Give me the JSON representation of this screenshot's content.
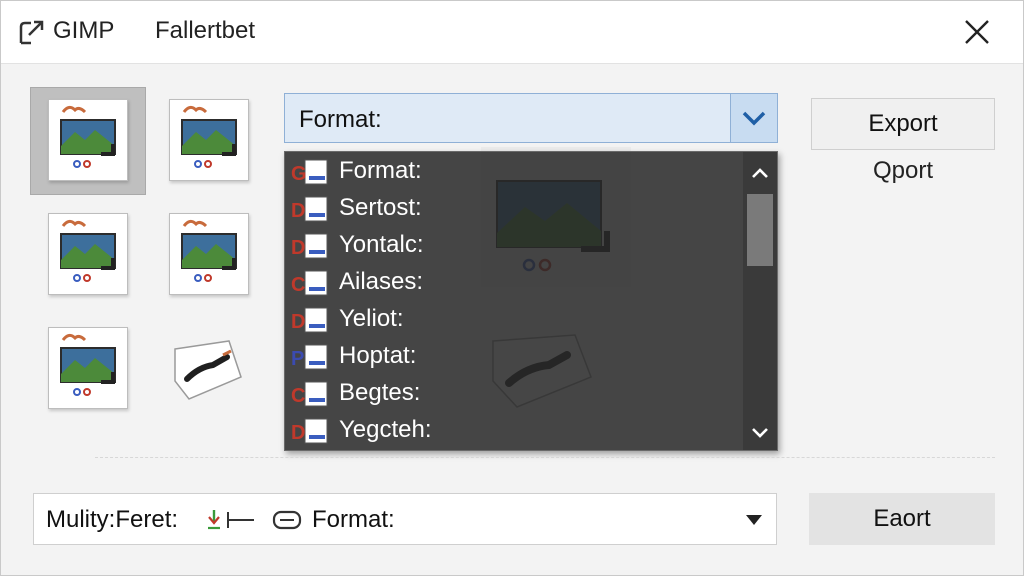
{
  "titlebar": {
    "app_name": "GIMP",
    "window_title": "Fallertbet"
  },
  "thumbnails": [
    {
      "icon": "image-file-icon",
      "selected": true
    },
    {
      "icon": "image-file-icon",
      "selected": false
    },
    {
      "icon": "image-file-icon",
      "selected": false
    },
    {
      "icon": "image-file-icon",
      "selected": false
    },
    {
      "icon": "image-file-icon",
      "selected": false
    },
    {
      "icon": "brush-stroke-icon",
      "selected": false
    }
  ],
  "format_select": {
    "label": "Format:"
  },
  "dropdown": {
    "items": [
      {
        "label": "Format:",
        "badge": "G",
        "badge_color": "#c0392b"
      },
      {
        "label": "Sertost:",
        "badge": "D",
        "badge_color": "#c0392b"
      },
      {
        "label": "Yontalc:",
        "badge": "D",
        "badge_color": "#c0392b"
      },
      {
        "label": "Ailases:",
        "badge": "C",
        "badge_color": "#c0392b"
      },
      {
        "label": "Yeliot:",
        "badge": "D",
        "badge_color": "#c0392b"
      },
      {
        "label": "Hoptat:",
        "badge": "P",
        "badge_color": "#3b4bb0"
      },
      {
        "label": "Begtes:",
        "badge": "C",
        "badge_color": "#c0392b"
      },
      {
        "label": "Yegcteh:",
        "badge": "D",
        "badge_color": "#c0392b"
      }
    ]
  },
  "side": {
    "export_label": "Export",
    "oport_label": "Qport"
  },
  "bottom": {
    "select_label": "Mulity:Feret:",
    "select_value": "Format:",
    "eaort_label": "Eaort"
  },
  "colors": {
    "accent": "#2f6fb3",
    "select_bg": "#dfeaf6",
    "dropdown_bg": "#282828"
  }
}
